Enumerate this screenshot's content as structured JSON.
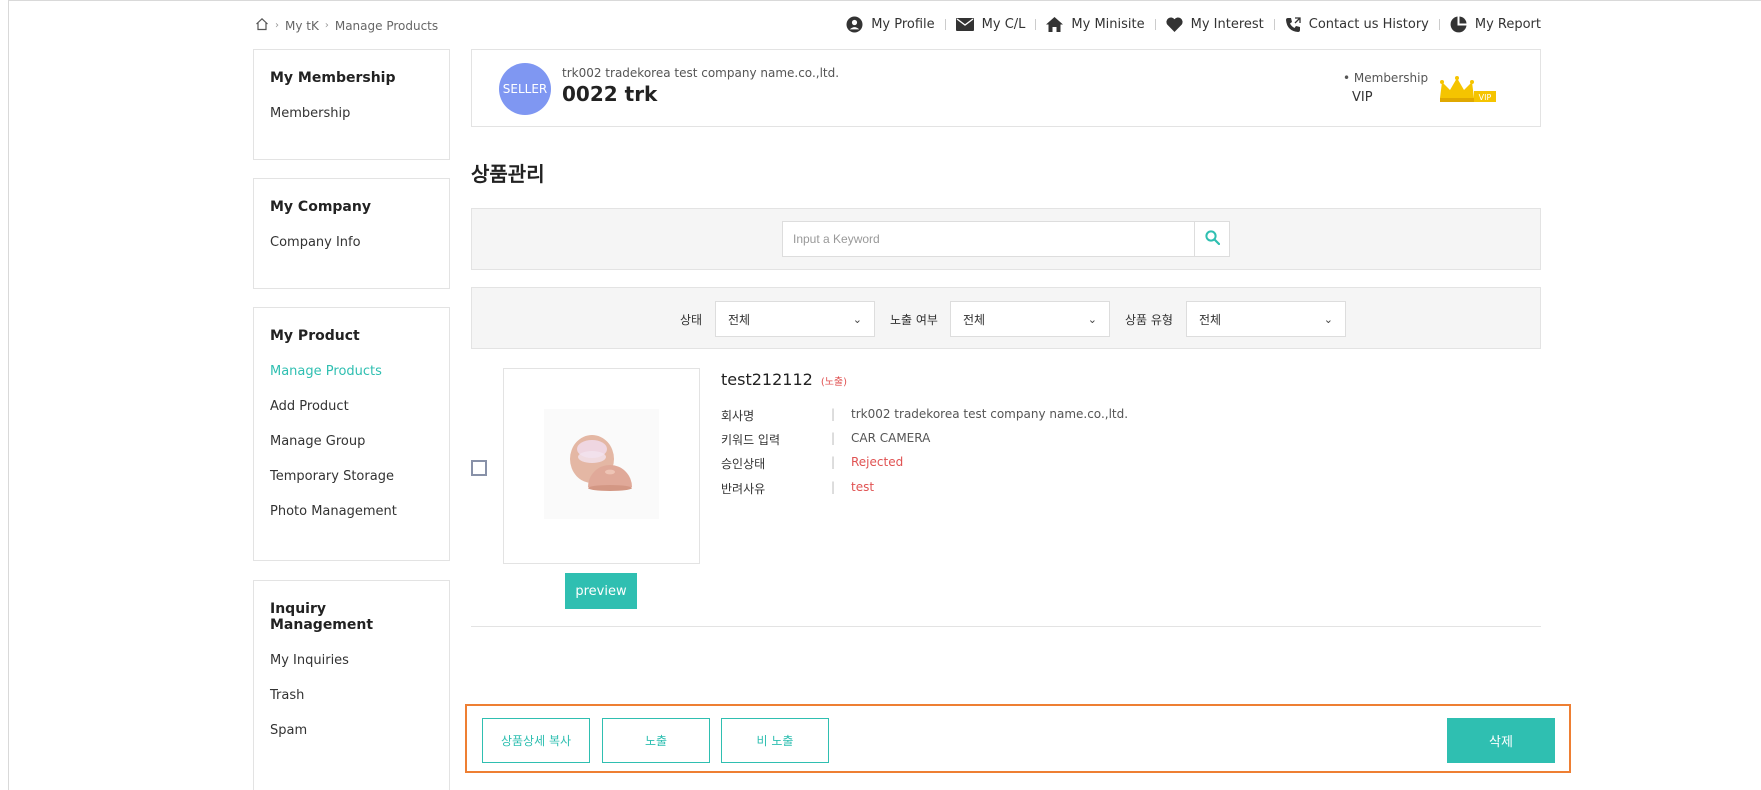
{
  "breadcrumb": {
    "home_icon": "home-icon",
    "items": [
      "My tK",
      "Manage Products"
    ]
  },
  "topnav": {
    "items": [
      {
        "label": "My Profile",
        "icon": "user-circle-icon"
      },
      {
        "label": "My C/L",
        "icon": "mail-icon"
      },
      {
        "label": "My Minisite",
        "icon": "home-filled-icon"
      },
      {
        "label": "My Interest",
        "icon": "heart-icon"
      },
      {
        "label": "Contact us History",
        "icon": "phone-icon"
      },
      {
        "label": "My Report",
        "icon": "pie-chart-icon"
      }
    ]
  },
  "sidebar": {
    "groups": [
      {
        "title": "My Membership",
        "links": [
          "Membership"
        ]
      },
      {
        "title": "My Company",
        "links": [
          "Company Info"
        ]
      },
      {
        "title": "My Product",
        "links": [
          "Manage Products",
          "Add Product",
          "Manage Group",
          "Temporary Storage",
          "Photo Management"
        ],
        "active": "Manage Products"
      },
      {
        "title": "Inquiry Management",
        "links": [
          "My Inquiries",
          "Trash",
          "Spam"
        ]
      }
    ]
  },
  "profile": {
    "badge": "SELLER",
    "company": "trk002 tradekorea test company name.co.,ltd.",
    "name": "0022 trk",
    "membership_label": "• Membership",
    "membership_value": "VIP",
    "crown_label": "VIP"
  },
  "page_title": "상품관리",
  "search": {
    "placeholder": "Input a Keyword",
    "value": ""
  },
  "filters": {
    "status": {
      "label": "상태",
      "value": "전체"
    },
    "exposure": {
      "label": "노출 여부",
      "value": "전체"
    },
    "type": {
      "label": "상품 유형",
      "value": "전체"
    }
  },
  "product": {
    "name": "test212112",
    "status": "(노출)",
    "preview_label": "preview",
    "details": [
      {
        "key": "회사명",
        "value": "trk002 tradekorea test company name.co.,ltd.",
        "highlight": false
      },
      {
        "key": "키워드 입력",
        "value": "CAR CAMERA",
        "highlight": false
      },
      {
        "key": "승인상태",
        "value": "Rejected",
        "highlight": true
      },
      {
        "key": "반려사유",
        "value": "test",
        "highlight": true
      }
    ]
  },
  "actions": {
    "copy_label": "상품상세 복사",
    "expose_label": "노출",
    "hide_label": "비 노출",
    "delete_label": "삭제"
  },
  "colors": {
    "accent": "#2fbfb1",
    "highlight_border": "#ee7f33",
    "badge": "#7f97f2",
    "reject": "#e05252"
  }
}
